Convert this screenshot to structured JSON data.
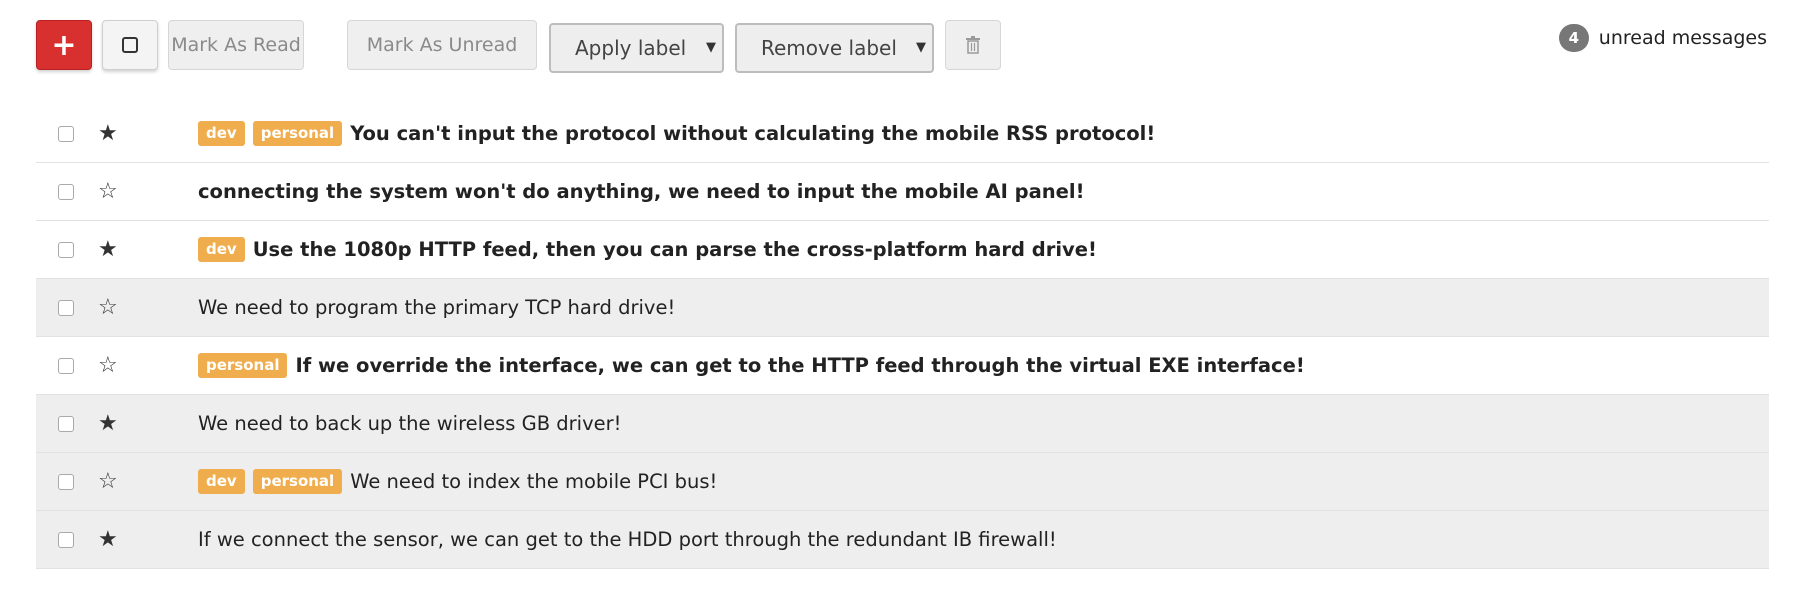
{
  "toolbar": {
    "compose_icon": "plus-icon",
    "compose_glyph": "+",
    "select_icon": "square-icon",
    "mark_read_label": "Mark As Read",
    "mark_unread_label": "Mark As Unread",
    "apply_label": "Apply label",
    "remove_label": "Remove label",
    "delete_icon": "trash-icon",
    "unread_count": "4",
    "unread_text": "unread messages"
  },
  "colors": {
    "compose": "#d8302f",
    "label": "#f0ad4e",
    "read_row": "#eeeeee"
  },
  "messages": [
    {
      "starred": true,
      "read": false,
      "labels": [
        "dev",
        "personal"
      ],
      "subject": "You can't input the protocol without calculating the mobile RSS protocol!"
    },
    {
      "starred": false,
      "read": false,
      "labels": [],
      "subject": "connecting the system won't do anything, we need to input the mobile AI panel!"
    },
    {
      "starred": true,
      "read": false,
      "labels": [
        "dev"
      ],
      "subject": "Use the 1080p HTTP feed, then you can parse the cross-platform hard drive!"
    },
    {
      "starred": false,
      "read": true,
      "labels": [],
      "subject": "We need to program the primary TCP hard drive!"
    },
    {
      "starred": false,
      "read": false,
      "labels": [
        "personal"
      ],
      "subject": "If we override the interface, we can get to the HTTP feed through the virtual EXE interface!"
    },
    {
      "starred": true,
      "read": true,
      "labels": [],
      "subject": "We need to back up the wireless GB driver!"
    },
    {
      "starred": false,
      "read": true,
      "labels": [
        "dev",
        "personal"
      ],
      "subject": "We need to index the mobile PCI bus!"
    },
    {
      "starred": true,
      "read": true,
      "labels": [],
      "subject": "If we connect the sensor, we can get to the HDD port through the redundant IB firewall!"
    }
  ]
}
